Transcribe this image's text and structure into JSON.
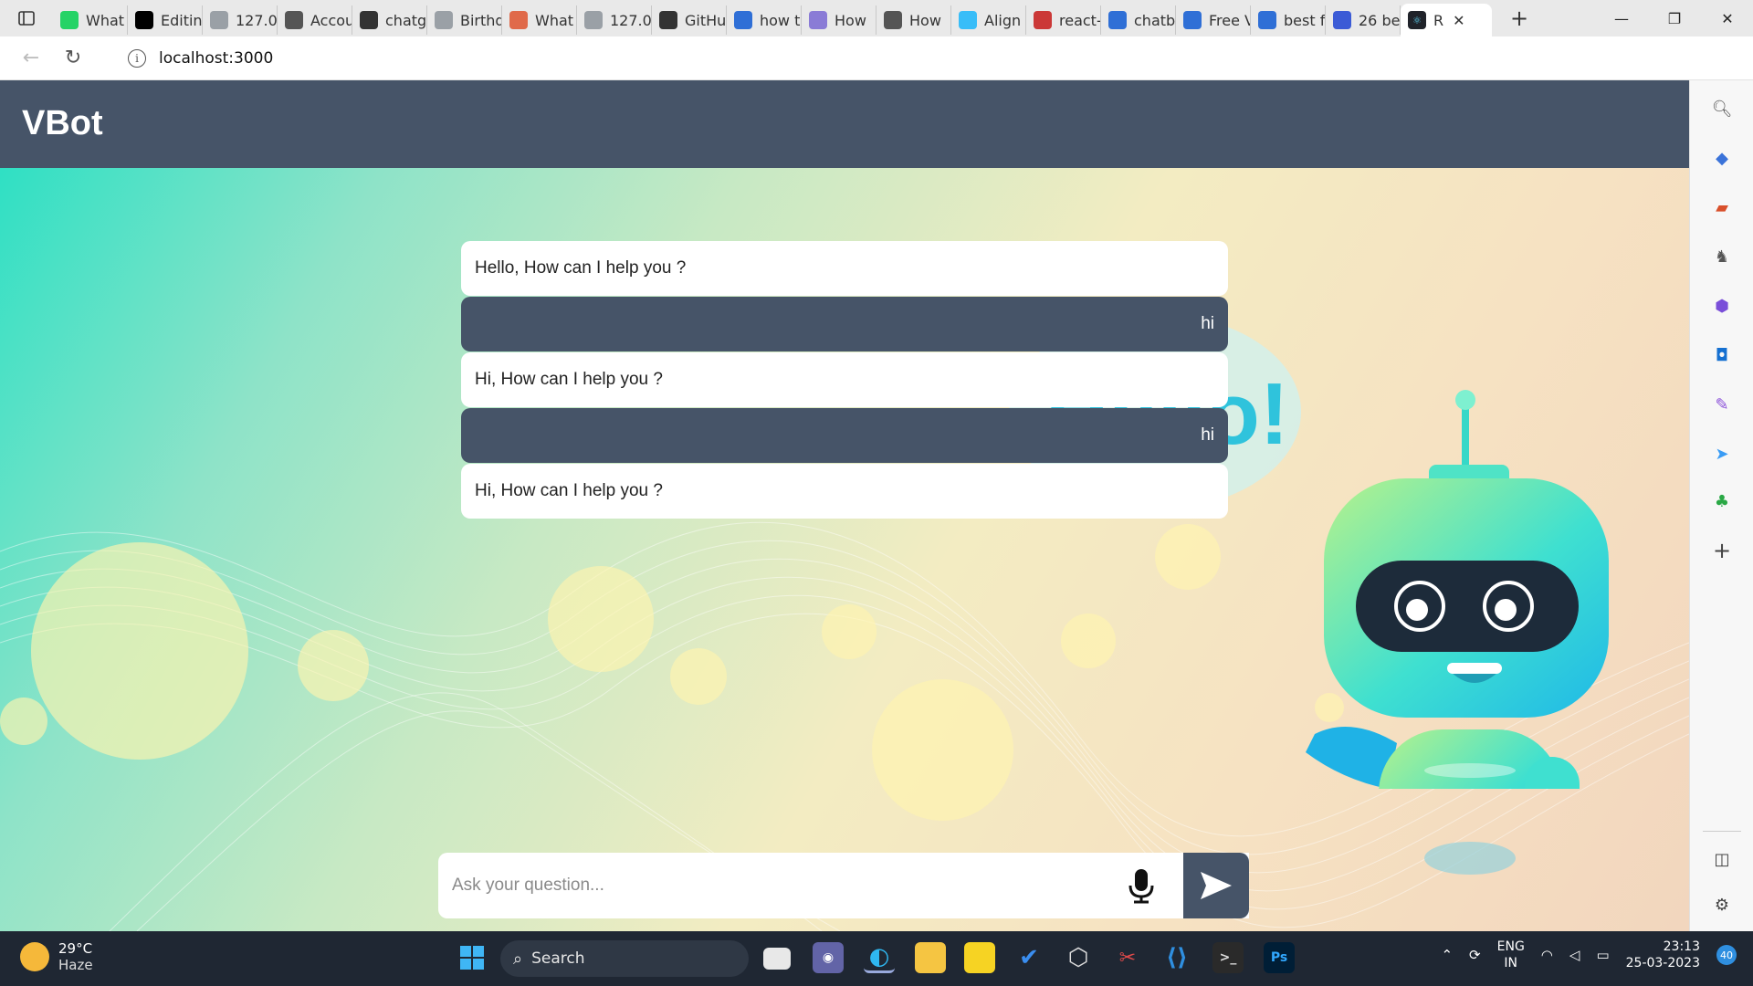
{
  "browser": {
    "tabs": [
      {
        "label": "What",
        "icon": "whatsapp-icon",
        "color": "#25d366"
      },
      {
        "label": "Editin",
        "icon": "medium-icon",
        "color": "#000000"
      },
      {
        "label": "127.0",
        "icon": "page-icon",
        "color": "#9aa0a6"
      },
      {
        "label": "Accou",
        "icon": "openai-icon",
        "color": "#555555"
      },
      {
        "label": "chatg",
        "icon": "github-icon",
        "color": "#333333"
      },
      {
        "label": "Birthd",
        "icon": "image-icon",
        "color": "#9aa0a6"
      },
      {
        "label": "What",
        "icon": "c-icon",
        "color": "#e06a4a"
      },
      {
        "label": "127.0",
        "icon": "page-icon",
        "color": "#9aa0a6"
      },
      {
        "label": "GitHu",
        "icon": "github-icon",
        "color": "#333333"
      },
      {
        "label": "how t",
        "icon": "search-icon",
        "color": "#2f6fd6"
      },
      {
        "label": "How",
        "icon": "a-icon",
        "color": "#8a7bd6"
      },
      {
        "label": "How",
        "icon": "video-icon",
        "color": "#555555"
      },
      {
        "label": "Align",
        "icon": "tailwind-icon",
        "color": "#38bdf8"
      },
      {
        "label": "react-",
        "icon": "npm-icon",
        "color": "#cb3837"
      },
      {
        "label": "chatb",
        "icon": "search-icon",
        "color": "#2f6fd6"
      },
      {
        "label": "Free V",
        "icon": "bot-icon",
        "color": "#2f6fd6"
      },
      {
        "label": "best f",
        "icon": "search-icon",
        "color": "#2f6fd6"
      },
      {
        "label": "26 be",
        "icon": "w-icon",
        "color": "#3b5bd6"
      }
    ],
    "active_tab": {
      "label": "R",
      "icon": "react-icon"
    },
    "url": "localhost:3000"
  },
  "app": {
    "title": "VBot",
    "messages": [
      {
        "role": "bot",
        "text": "Hello, How can I help you ?"
      },
      {
        "role": "user",
        "text": "hi"
      },
      {
        "role": "bot",
        "text": "Hi, How can I help you ?"
      },
      {
        "role": "user",
        "text": "hi"
      },
      {
        "role": "bot",
        "text": "Hi, How can I help you ?"
      }
    ],
    "input": {
      "placeholder": "Ask your question...",
      "value": ""
    },
    "background_text": "Hello!",
    "colors": {
      "header": "#465468",
      "user_bubble": "#465468",
      "bot_bubble": "#ffffff"
    }
  },
  "taskbar": {
    "weather": {
      "temp": "29°C",
      "condition": "Haze"
    },
    "search_label": "Search",
    "lang": {
      "line1": "ENG",
      "line2": "IN"
    },
    "clock": {
      "time": "23:13",
      "date": "25-03-2023"
    },
    "notifications": "40"
  }
}
